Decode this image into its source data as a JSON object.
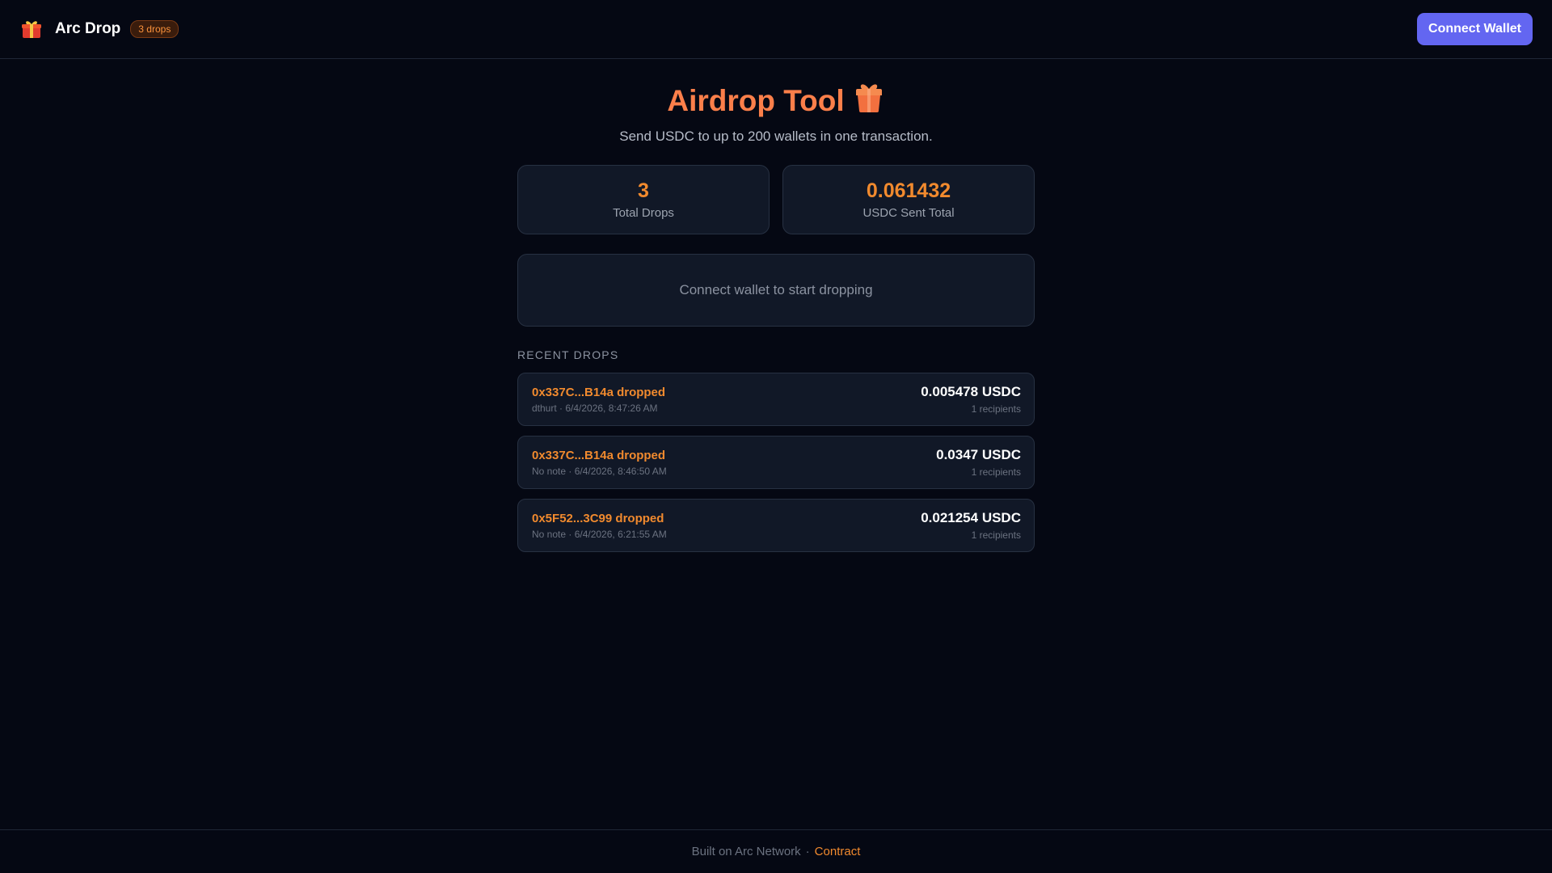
{
  "header": {
    "app_name": "Arc Drop",
    "drops_badge": "3 drops",
    "connect_label": "Connect Wallet",
    "icon": "gift-icon"
  },
  "hero": {
    "title": "Airdrop Tool",
    "subtitle": "Send USDC to up to 200 wallets in one transaction."
  },
  "stats": [
    {
      "value": "3",
      "label": "Total Drops"
    },
    {
      "value": "0.061432",
      "label": "USDC Sent Total"
    }
  ],
  "connect_prompt": "Connect wallet to start dropping",
  "recent": {
    "title": "RECENT DROPS",
    "items": [
      {
        "title": "0x337C...B14a dropped",
        "meta": "dthurt · 6/4/2026, 8:47:26 AM",
        "amount": "0.005478 USDC",
        "recipients": "1 recipients"
      },
      {
        "title": "0x337C...B14a dropped",
        "meta": "No note · 6/4/2026, 8:46:50 AM",
        "amount": "0.0347 USDC",
        "recipients": "1 recipients"
      },
      {
        "title": "0x5F52...3C99 dropped",
        "meta": "No note · 6/4/2026, 6:21:55 AM",
        "amount": "0.021254 USDC",
        "recipients": "1 recipients"
      }
    ]
  },
  "footer": {
    "text": "Built on Arc Network",
    "separator": "·",
    "link": "Contract"
  },
  "colors": {
    "accent": "#f18a2e",
    "brand": "#6366f1",
    "background": "#050813",
    "card": "#111827"
  }
}
